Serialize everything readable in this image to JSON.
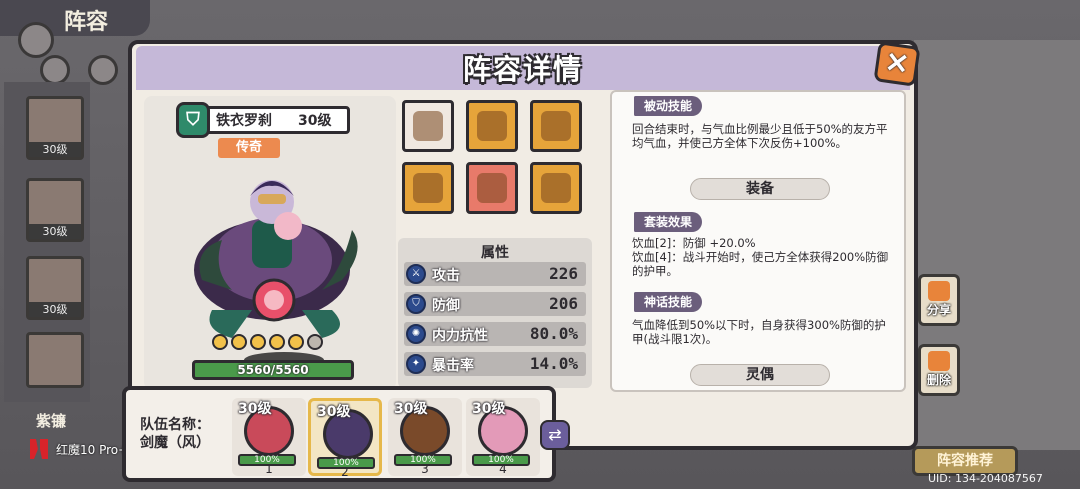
{
  "background": {
    "screen_title": "阵容",
    "sidebar_levels": [
      "30级",
      "30级",
      "30级"
    ],
    "sidebar_selected_name": "紫镰",
    "side_buttons": {
      "share": "分享",
      "delete": "删除"
    },
    "recommend_button": "阵容推荐",
    "uid": "UID: 134-204087567",
    "device_watermark": "红魔10 Pro+"
  },
  "modal": {
    "title": "阵容详情",
    "close_icon": "×"
  },
  "hero": {
    "name": "铁衣罗刹",
    "level": "30级",
    "rarity": "传奇",
    "stars_filled": 5,
    "stars_total": 6,
    "hp": "5560/5560",
    "emblem_icon": "shield-emblem-icon"
  },
  "equipment": {
    "icons": [
      "pink-pig-relic-icon",
      "pot-icon",
      "chest-armor-icon",
      "boots-icon",
      "pet-beast-icon",
      "tiger-figurine-icon"
    ],
    "colors": [
      "#f0e8e0",
      "#e6a43a",
      "#e6a43a",
      "#e6a43a",
      "#e87a6a",
      "#e6a43a"
    ]
  },
  "attributes": {
    "title": "属性",
    "rows": [
      {
        "label": "攻击",
        "value": "226",
        "icon": "sword-icon"
      },
      {
        "label": "防御",
        "value": "206",
        "icon": "shield-icon"
      },
      {
        "label": "内力抗性",
        "value": "80.0%",
        "icon": "swirl-icon"
      },
      {
        "label": "暴击率",
        "value": "14.0%",
        "icon": "critical-icon"
      }
    ]
  },
  "skills": {
    "passive": {
      "tag": "被动技能",
      "text": "回合结束时，与气血比例最少且低于50%的友方平均气血，并使己方全体下次反伤+100%。"
    },
    "equip_header": "装备",
    "set_effect": {
      "tag": "套装效果",
      "line1": "饮血[2]：防御 +20.0%",
      "line2": "饮血[4]：战斗开始时，使己方全体获得200%防御的护甲。"
    },
    "myth": {
      "tag": "神话技能",
      "text": "气血降低到50%以下时，自身获得300%防御的护甲(战斗限1次)。"
    },
    "puppet_header": "灵偶"
  },
  "team": {
    "label_line1": "队伍名称：",
    "label_line2": "剑魔（风）",
    "members": [
      {
        "level": "30级",
        "hp": "100%",
        "index": "1",
        "color": "#c94a5a"
      },
      {
        "level": "30级",
        "hp": "100%",
        "index": "2",
        "color": "#4a3a6a"
      },
      {
        "level": "30级",
        "hp": "100%",
        "index": "3",
        "color": "#7a4a2a"
      },
      {
        "level": "30级",
        "hp": "100%",
        "index": "4",
        "color": "#e39ab8"
      }
    ],
    "swap_icon": "swap-icon"
  }
}
